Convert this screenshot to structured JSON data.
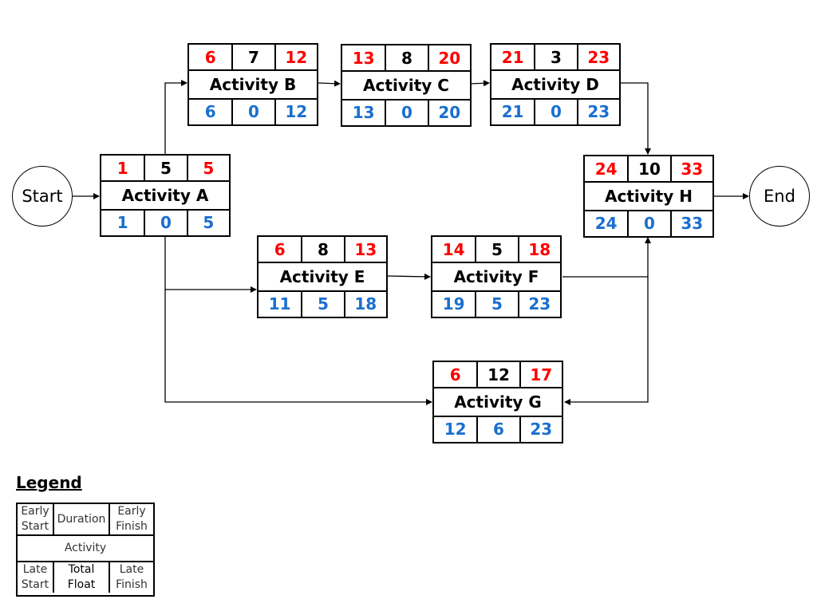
{
  "colors": {
    "early": "#ff0000",
    "duration": "#000000",
    "late": "#1a6fcf"
  },
  "start_label": "Start",
  "end_label": "End",
  "activities": [
    {
      "id": "a",
      "name": "Activity A",
      "es": "1",
      "dur": "5",
      "ef": "5",
      "ls": "1",
      "tf": "0",
      "lf": "5"
    },
    {
      "id": "b",
      "name": "Activity B",
      "es": "6",
      "dur": "7",
      "ef": "12",
      "ls": "6",
      "tf": "0",
      "lf": "12"
    },
    {
      "id": "c",
      "name": "Activity C",
      "es": "13",
      "dur": "8",
      "ef": "20",
      "ls": "13",
      "tf": "0",
      "lf": "20"
    },
    {
      "id": "d",
      "name": "Activity D",
      "es": "21",
      "dur": "3",
      "ef": "23",
      "ls": "21",
      "tf": "0",
      "lf": "23"
    },
    {
      "id": "e",
      "name": "Activity E",
      "es": "6",
      "dur": "8",
      "ef": "13",
      "ls": "11",
      "tf": "5",
      "lf": "18"
    },
    {
      "id": "f",
      "name": "Activity F",
      "es": "14",
      "dur": "5",
      "ef": "18",
      "ls": "19",
      "tf": "5",
      "lf": "23"
    },
    {
      "id": "g",
      "name": "Activity G",
      "es": "6",
      "dur": "12",
      "ef": "17",
      "ls": "12",
      "tf": "6",
      "lf": "23"
    },
    {
      "id": "h",
      "name": "Activity H",
      "es": "24",
      "dur": "10",
      "ef": "33",
      "ls": "24",
      "tf": "0",
      "lf": "33"
    }
  ],
  "legend": {
    "title": "Legend",
    "early_start": "Early Start",
    "duration": "Duration",
    "early_finish": "Early Finish",
    "activity": "Activity",
    "late_start": "Late Start",
    "total_float": "Total Float",
    "late_finish": "Late Finish"
  }
}
